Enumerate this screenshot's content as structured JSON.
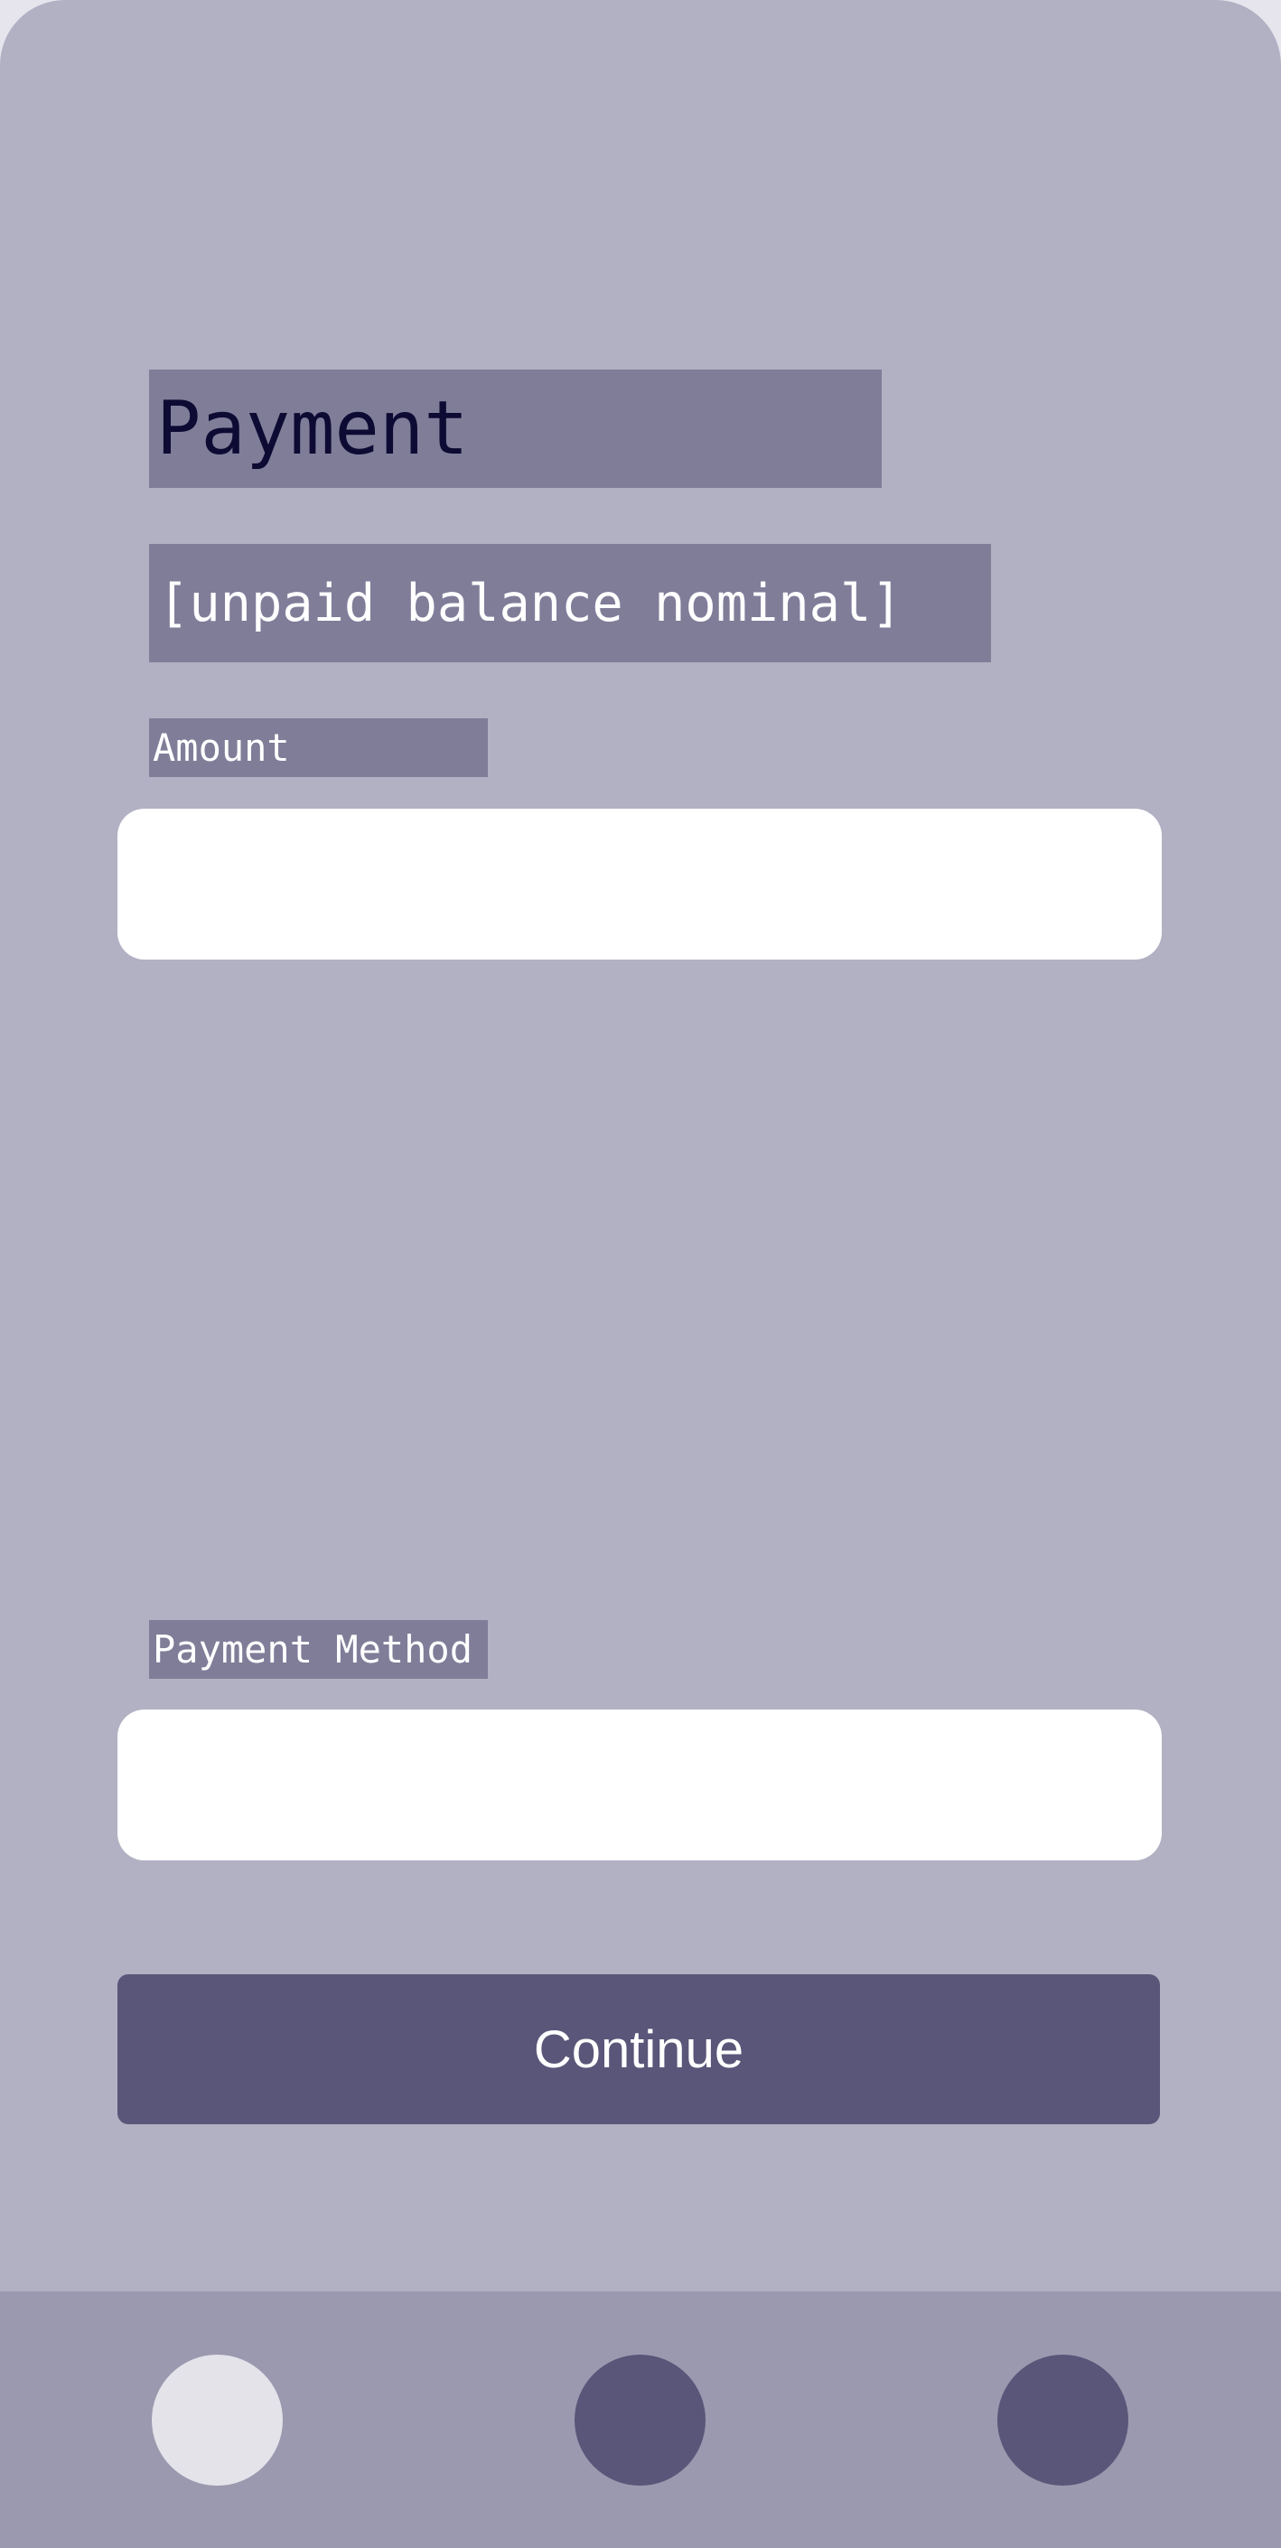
{
  "header": {
    "title": "Payment",
    "subtitle": "[unpaid balance nominal]"
  },
  "form": {
    "amount_label": "Amount",
    "amount_value": "",
    "method_label": "Payment Method",
    "method_value": "",
    "continue_label": "Continue"
  },
  "bottom_nav": {
    "items": [
      {
        "icon": "nav-circle-icon",
        "state": "active"
      },
      {
        "icon": "nav-circle-icon",
        "state": "inactive"
      },
      {
        "icon": "nav-circle-icon",
        "state": "inactive"
      }
    ]
  },
  "colors": {
    "background": "#b2b0c3",
    "label_block": "#807d99",
    "accent": "#5a5679",
    "nav_bar": "#9b99af",
    "nav_active": "#e4e3ea"
  }
}
